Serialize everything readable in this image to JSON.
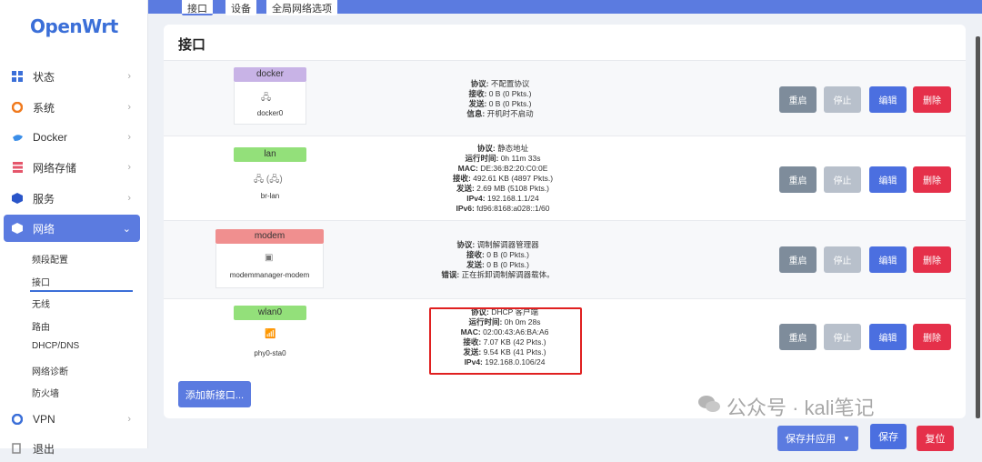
{
  "app": {
    "logo": "OpenWrt"
  },
  "sidebar": {
    "items": [
      {
        "label": "状态",
        "icon": "grid-icon"
      },
      {
        "label": "系统",
        "icon": "gear-icon"
      },
      {
        "label": "Docker",
        "icon": "docker-icon"
      },
      {
        "label": "网络存储",
        "icon": "storage-icon"
      },
      {
        "label": "服务",
        "icon": "cube-icon"
      },
      {
        "label": "网络",
        "icon": "cube-icon"
      },
      {
        "label": "VPN",
        "icon": "vpn-icon"
      },
      {
        "label": "退出",
        "icon": "logout-icon"
      }
    ],
    "sub": [
      "频段配置",
      "接口",
      "无线",
      "路由",
      "DHCP/DNS",
      "网络诊断",
      "防火墙"
    ]
  },
  "tabs": [
    "接口",
    "设备",
    "全局网络选项"
  ],
  "page": {
    "title": "接口"
  },
  "buttons": {
    "restart": "重启",
    "stop": "停止",
    "edit": "编辑",
    "delete": "删除"
  },
  "interfaces": [
    {
      "name": "docker",
      "device": "docker0",
      "color": "#c8b3e6",
      "lines": [
        {
          "k": "协议:",
          "v": " 不配置协议"
        },
        {
          "k": "接收:",
          "v": " 0 B (0 Pkts.)"
        },
        {
          "k": "发送:",
          "v": " 0 B (0 Pkts.)"
        },
        {
          "k": "信息:",
          "v": " 开机时不启动"
        }
      ]
    },
    {
      "name": "lan",
      "device": "br-lan",
      "color": "#93e07a",
      "lines": [
        {
          "k": "协议:",
          "v": " 静态地址"
        },
        {
          "k": "运行时间:",
          "v": " 0h 11m 33s"
        },
        {
          "k": "MAC:",
          "v": " DE:36:B2:20:C0:0E"
        },
        {
          "k": "接收:",
          "v": " 492.61 KB (4897 Pkts.)"
        },
        {
          "k": "发送:",
          "v": " 2.69 MB (5108 Pkts.)"
        },
        {
          "k": "IPv4:",
          "v": " 192.168.1.1/24"
        },
        {
          "k": "IPv6:",
          "v": " fd96:8168:a028::1/60"
        }
      ]
    },
    {
      "name": "modem",
      "device": "modemmanager-modem",
      "color": "#f08f8f",
      "lines": [
        {
          "k": "协议:",
          "v": " 调制解调器管理器"
        },
        {
          "k": "接收:",
          "v": " 0 B (0 Pkts.)"
        },
        {
          "k": "发送:",
          "v": " 0 B (0 Pkts.)"
        },
        {
          "k": "错误:",
          "v": " 正在拆卸调制解调器载体。"
        }
      ]
    },
    {
      "name": "wlan0",
      "device": "phy0-sta0",
      "color": "#93e07a",
      "lines": [
        {
          "k": "协议:",
          "v": " DHCP 客户端"
        },
        {
          "k": "运行时间:",
          "v": " 0h 0m 28s"
        },
        {
          "k": "MAC:",
          "v": " 02:00:43:A6:BA:A6"
        },
        {
          "k": "接收:",
          "v": " 7.07 KB (42 Pkts.)"
        },
        {
          "k": "发送:",
          "v": " 9.54 KB (41 Pkts.)"
        },
        {
          "k": "IPv4:",
          "v": " 192.168.0.106/24"
        }
      ]
    }
  ],
  "add_interface": "添加新接口...",
  "footer": {
    "save_apply": "保存并应用",
    "save": "保存",
    "reset": "复位"
  },
  "watermark": "公众号 · kali笔记"
}
